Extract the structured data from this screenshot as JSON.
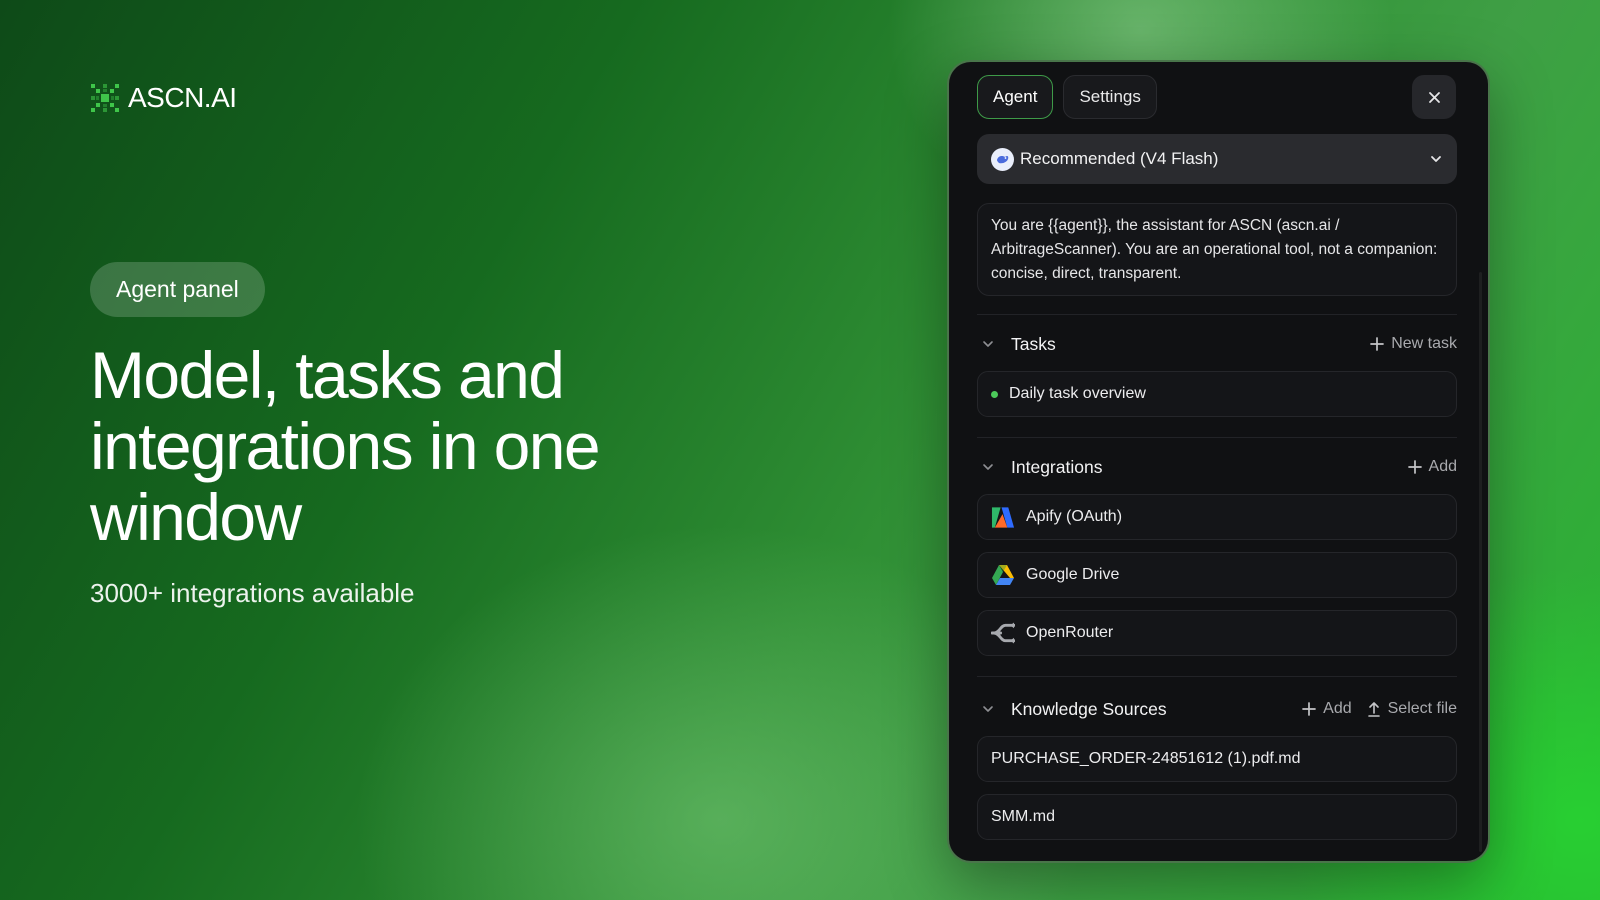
{
  "brand": {
    "name": "ASCN.AI",
    "logo_icon": "ascn-logo-icon"
  },
  "hero": {
    "badge": "Agent panel",
    "headline": "Model, tasks and integrations in one window",
    "subline": "3000+ integrations available"
  },
  "panel": {
    "tabs": [
      {
        "label": "Agent",
        "active": true
      },
      {
        "label": "Settings",
        "active": false
      }
    ],
    "close_icon": "close-icon",
    "model": {
      "label": "Recommended (V4 Flash)",
      "icon": "model-avatar-icon"
    },
    "prompt": "You are {{agent}}, the assistant for ASCN (ascn.ai / ArbitrageScanner). You are an operational tool, not a companion: concise, direct, transparent.",
    "tasks": {
      "title": "Tasks",
      "action": "New task",
      "items": [
        {
          "label": "Daily task overview",
          "status_color": "#4cc95a"
        }
      ]
    },
    "integrations": {
      "title": "Integrations",
      "action": "Add",
      "items": [
        {
          "label": "Apify (OAuth)",
          "icon": "apify-icon"
        },
        {
          "label": "Google Drive",
          "icon": "google-drive-icon"
        },
        {
          "label": "OpenRouter",
          "icon": "openrouter-icon"
        }
      ]
    },
    "knowledge": {
      "title": "Knowledge Sources",
      "action_add": "Add",
      "action_file": "Select file",
      "items": [
        {
          "label": "PURCHASE_ORDER-24851612 (1).pdf.md"
        },
        {
          "label": "SMM.md"
        }
      ]
    }
  },
  "colors": {
    "accent_green": "#3e9a48",
    "panel_bg": "#101113",
    "status_green": "#4cc95a"
  }
}
